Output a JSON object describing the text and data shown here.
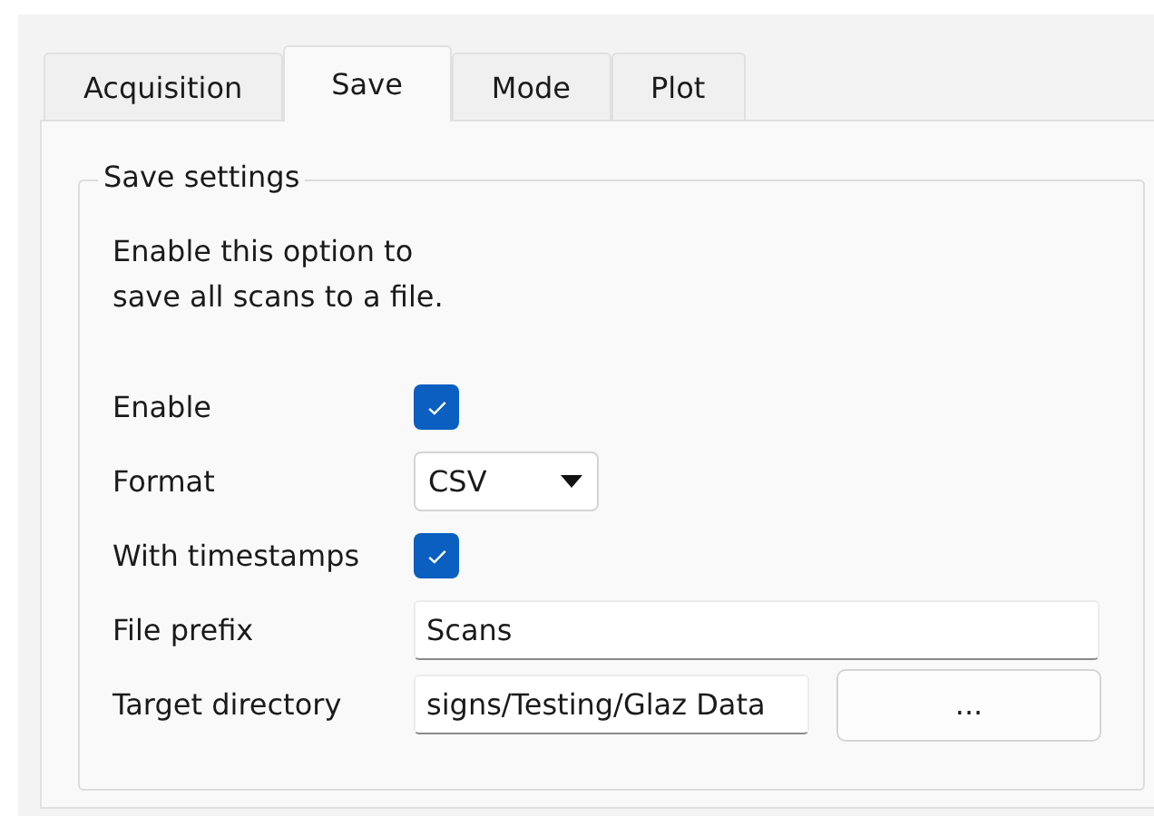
{
  "tabs": [
    {
      "label": "Acquisition",
      "selected": false
    },
    {
      "label": "Save",
      "selected": true
    },
    {
      "label": "Mode",
      "selected": false
    },
    {
      "label": "Plot",
      "selected": false
    }
  ],
  "group": {
    "title": "Save settings",
    "description": "Enable this option to\nsave all scans to a file."
  },
  "rows": [
    {
      "kind": "checkbox",
      "label": "Enable",
      "checked": true
    },
    {
      "kind": "combo",
      "label": "Format",
      "value": "CSV"
    },
    {
      "kind": "checkbox",
      "label": "With timestamps",
      "checked": true
    },
    {
      "kind": "text",
      "label": "File prefix",
      "value": "Scans"
    },
    {
      "kind": "path",
      "label": "Target directory",
      "value": "signs/Testing/Glaz Data",
      "button": "..."
    }
  ]
}
